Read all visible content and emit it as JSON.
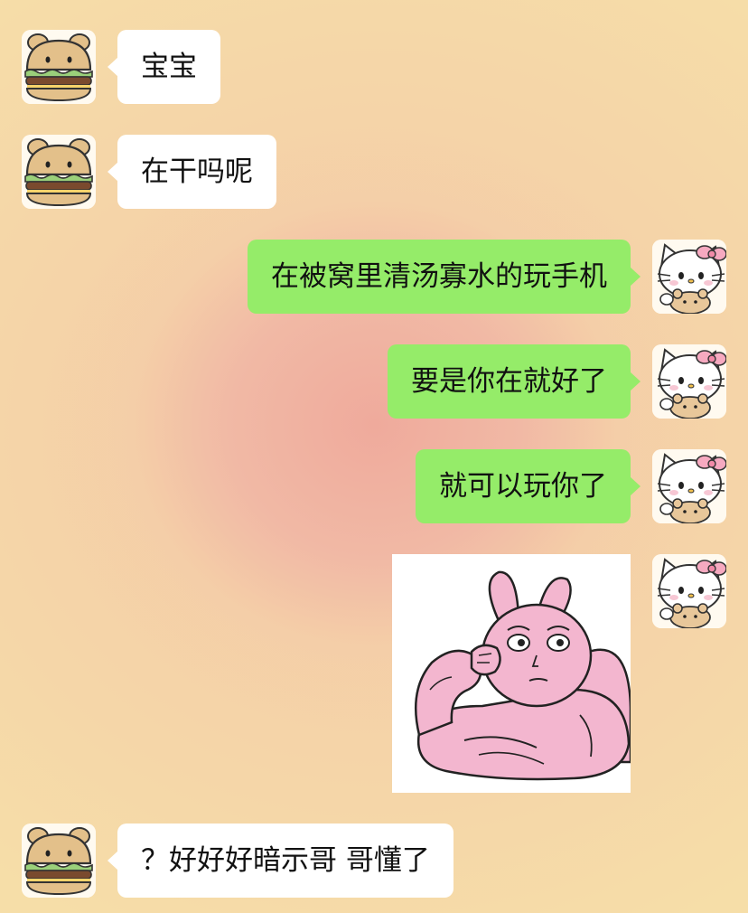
{
  "chat": {
    "messages": [
      {
        "side": "incoming",
        "type": "text",
        "text": "宝宝"
      },
      {
        "side": "incoming",
        "type": "text",
        "text": "在干吗呢"
      },
      {
        "side": "outgoing",
        "type": "text",
        "text": "在被窝里清汤寡水的玩手机"
      },
      {
        "side": "outgoing",
        "type": "text",
        "text": "要是你在就好了"
      },
      {
        "side": "outgoing",
        "type": "text",
        "text": "就可以玩你了"
      },
      {
        "side": "outgoing",
        "type": "sticker",
        "sticker": "muscular-pink-bunny"
      },
      {
        "side": "incoming",
        "type": "text",
        "text": "？好好好暗示哥 哥懂了"
      }
    ]
  },
  "avatars": {
    "incoming": "hamburger-bear-avatar",
    "outgoing": "hello-kitty-avatar"
  },
  "colors": {
    "incoming_bubble": "#ffffff",
    "outgoing_bubble": "#95ec69",
    "background": "#f5d7a8",
    "background_center": "#efaa9c"
  }
}
